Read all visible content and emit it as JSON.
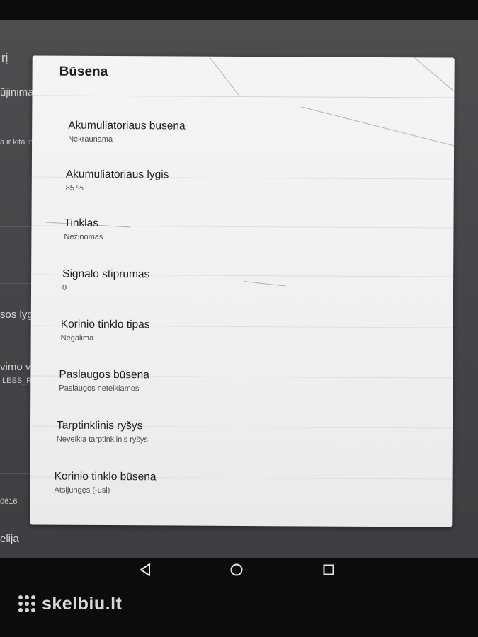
{
  "background_fragments": [
    "rį",
    "ūjinimas",
    "a ir kita infor",
    "sos lygis",
    "vimo ve",
    "ILESS_RE",
    "0616",
    "elija"
  ],
  "dialog": {
    "title": "Būsena",
    "items": [
      {
        "title": "Akumuliatoriaus būsena",
        "value": "Nekraunama"
      },
      {
        "title": "Akumuliatoriaus lygis",
        "value": "85 %"
      },
      {
        "title": "Tinklas",
        "value": "Nežinomas"
      },
      {
        "title": "Signalo stiprumas",
        "value": "0"
      },
      {
        "title": "Korinio tinklo tipas",
        "value": "Negalima"
      },
      {
        "title": "Paslaugos būsena",
        "value": "Paslaugos neteikiamos"
      },
      {
        "title": "Tarptinklinis ryšys",
        "value": "Neveikia tarptinklinis ryšys"
      },
      {
        "title": "Korinio tinklo būsena",
        "value": "Atsijungęs (-usi)"
      }
    ]
  },
  "navbar": {
    "back_icon": "back-triangle-icon",
    "home_icon": "home-circle-icon",
    "recents_icon": "recents-square-icon"
  },
  "watermark": {
    "text": "skelbiu.lt"
  }
}
